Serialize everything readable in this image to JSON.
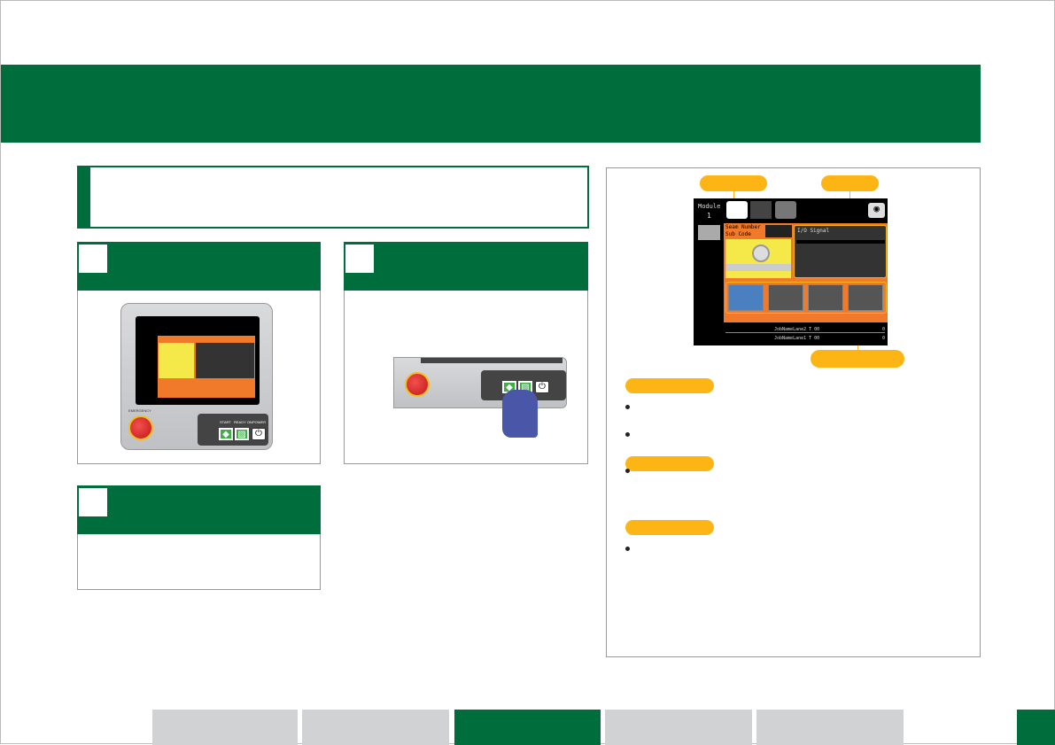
{
  "colors": {
    "brand_green": "#006e3c",
    "accent_yellow": "#fdb515",
    "tab_gray": "#d1d2d4",
    "screen_orange": "#f07a2a"
  },
  "screen": {
    "module_label": "Module",
    "module_number": "1",
    "seam_label": "Seam Number",
    "sub_code_label": "Sub Code",
    "io_title": "I/O Signal",
    "job_lines": [
      {
        "name": "JobNameLane2 T 00",
        "value": "0"
      },
      {
        "name": "JobNameLane1 T 00",
        "value": "0"
      }
    ]
  },
  "panel": {
    "emergency": "EMERGENCY",
    "start": "START",
    "ready_on": "READY ON",
    "power": "POWER"
  },
  "icons": [
    "camera-icon",
    "pressure-gauge-icon",
    "wrench-icon",
    "power-icon",
    "start-icon",
    "hand-pointer-icon"
  ],
  "footer_tabs": [
    {
      "active": false
    },
    {
      "active": false
    },
    {
      "active": true
    },
    {
      "active": false
    },
    {
      "active": false
    }
  ]
}
